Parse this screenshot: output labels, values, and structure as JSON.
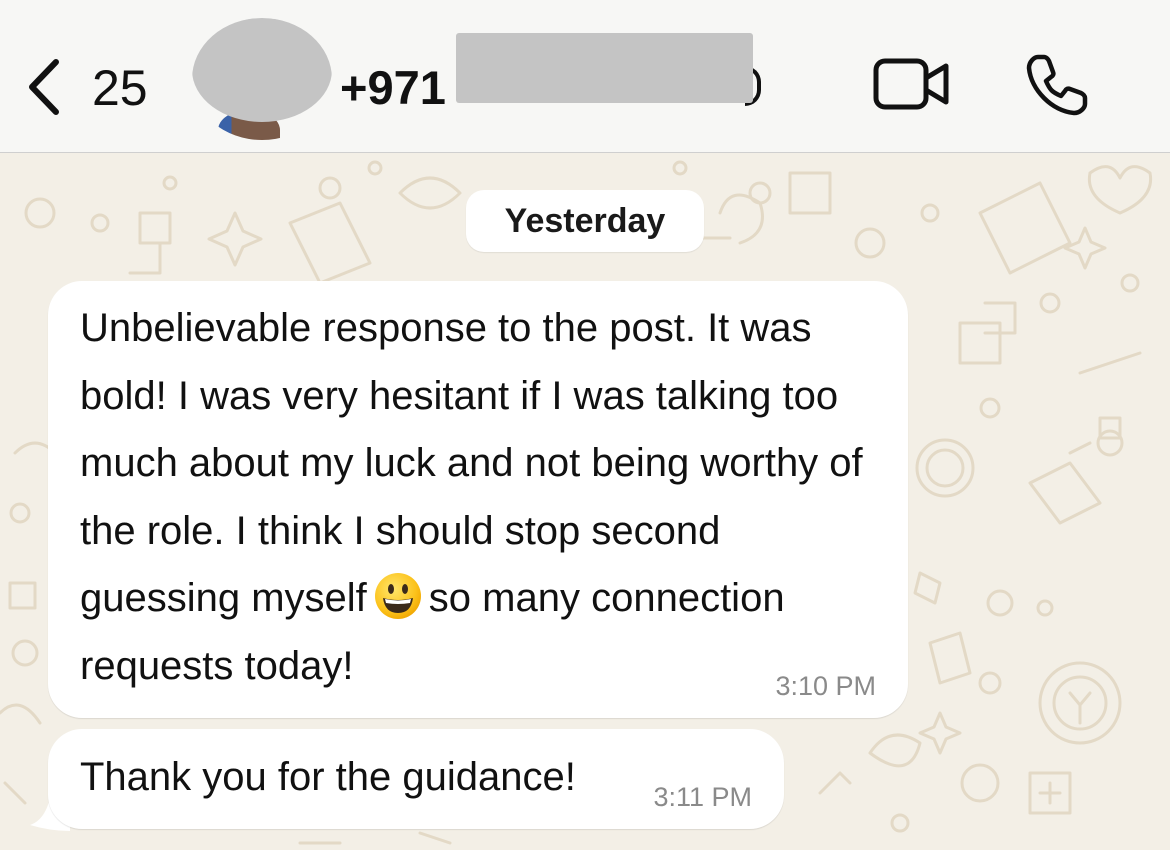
{
  "header": {
    "back_count": "25",
    "contact_name": "+971",
    "icons": {
      "back": "chevron-left-icon",
      "video": "video-camera-icon",
      "call": "phone-icon"
    }
  },
  "chat": {
    "date_separator": "Yesterday",
    "messages": [
      {
        "text_before_emoji": "Unbelievable response to the post. It was bold! I was very hesitant if I was talking too much about my luck and not being worthy of the role. I think I should stop second guessing myself",
        "emoji": "grinning-face-emoji",
        "text_after_emoji": "so many connection requests today!",
        "time": "3:10 PM"
      },
      {
        "text": "Thank you for the guidance!",
        "time": "3:11 PM"
      }
    ]
  },
  "colors": {
    "header_bg": "#f7f7f5",
    "wallpaper_bg": "#f3efe6",
    "bubble_bg": "#ffffff",
    "timestamp": "#8a8a8a",
    "redaction": "#c4c4c4"
  }
}
